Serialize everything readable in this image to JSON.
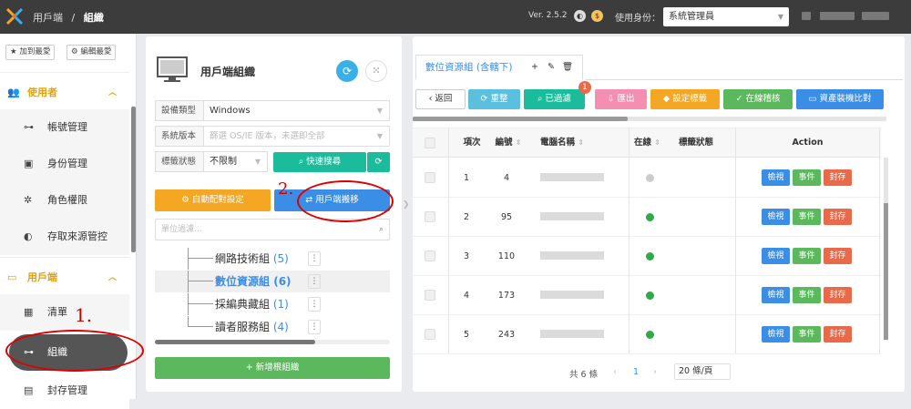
{
  "topbar": {
    "app": "用戶端",
    "separator": "/",
    "page": "組織",
    "version": "Ver. 2.5.2",
    "identity_label": "使用身份：",
    "role": "系統管理員"
  },
  "sidebar": {
    "fav_add": "加到最愛",
    "fav_edit": "編輯最愛",
    "groups": [
      {
        "label": "使用者",
        "icon": "users-icon",
        "items": [
          {
            "label": "帳號管理",
            "icon": "sitemap-icon"
          },
          {
            "label": "身份管理",
            "icon": "id-card-icon"
          },
          {
            "label": "角色權限",
            "icon": "roles-icon"
          },
          {
            "label": "存取來源管控",
            "icon": "shield-icon"
          }
        ]
      },
      {
        "label": "用戶端",
        "icon": "desktop-icon",
        "items": [
          {
            "label": "清單",
            "icon": "table-icon"
          },
          {
            "label": "組織",
            "icon": "sitemap-icon",
            "active": true
          },
          {
            "label": "封存管理",
            "icon": "archive-icon"
          }
        ]
      }
    ]
  },
  "org": {
    "title": "用戶端組織",
    "fields": [
      {
        "label": "設備類型",
        "value": "Windows",
        "placeholder": ""
      },
      {
        "label": "系統版本",
        "value": "",
        "placeholder": "篩選 OS/IE 版本，未選即全部"
      },
      {
        "label": "標籤狀態",
        "value": "不限制",
        "placeholder": ""
      }
    ],
    "quick_search": "快速搜尋",
    "auto_config": "自動配對設定",
    "migrate": "用戶端搬移",
    "filter_placeholder": "單位過濾...",
    "tree": [
      {
        "label": "網路技術組",
        "count": "(5)"
      },
      {
        "label": "數位資源組",
        "count": "(6)",
        "selected": true
      },
      {
        "label": "採編典藏組",
        "count": "(1)"
      },
      {
        "label": "讀者服務組",
        "count": "(4)"
      }
    ],
    "add_root": "新增根組織"
  },
  "main": {
    "tab": "數位資源組 (含轄下)",
    "toolbar": [
      {
        "label": "返回",
        "icon": "chevron-left-icon",
        "color": "#ffffff"
      },
      {
        "label": "重整",
        "icon": "refresh-icon",
        "color": "#5bc0de"
      },
      {
        "label": "已過濾",
        "icon": "search-icon",
        "color": "#1abc9c"
      },
      {
        "label": "匯出",
        "icon": "download-icon",
        "color": "#f48fb1"
      },
      {
        "label": "設定標籤",
        "icon": "tag-icon",
        "color": "#f5a623"
      },
      {
        "label": "在線稽核",
        "icon": "check-circle-icon",
        "color": "#5cb85c"
      },
      {
        "label": "資產裝機比對",
        "icon": "monitor-icon",
        "color": "#3a8ee6"
      }
    ],
    "filter_badge": "1",
    "columns": [
      "項次",
      "編號",
      "電腦名稱",
      "在線",
      "標籤狀態",
      "Action"
    ],
    "rows": [
      {
        "index": "1",
        "id": "4",
        "online": false
      },
      {
        "index": "2",
        "id": "95",
        "online": true
      },
      {
        "index": "3",
        "id": "110",
        "online": true
      },
      {
        "index": "4",
        "id": "173",
        "online": true
      },
      {
        "index": "5",
        "id": "243",
        "online": true
      }
    ],
    "actions": [
      "檢視",
      "事件",
      "封存"
    ],
    "action_colors": [
      "#3a8ee6",
      "#5cb85c",
      "#e86a4a"
    ],
    "pager": {
      "total": "共 6 條",
      "prev": "‹",
      "page": "1",
      "next": "›",
      "size": "20 條/頁"
    }
  },
  "annotations": [
    "1.",
    "2."
  ],
  "colors": {
    "accent": "#e6a100",
    "primary": "#3a8ee6",
    "online": "#2eaa4a",
    "offline": "#cccccc"
  }
}
